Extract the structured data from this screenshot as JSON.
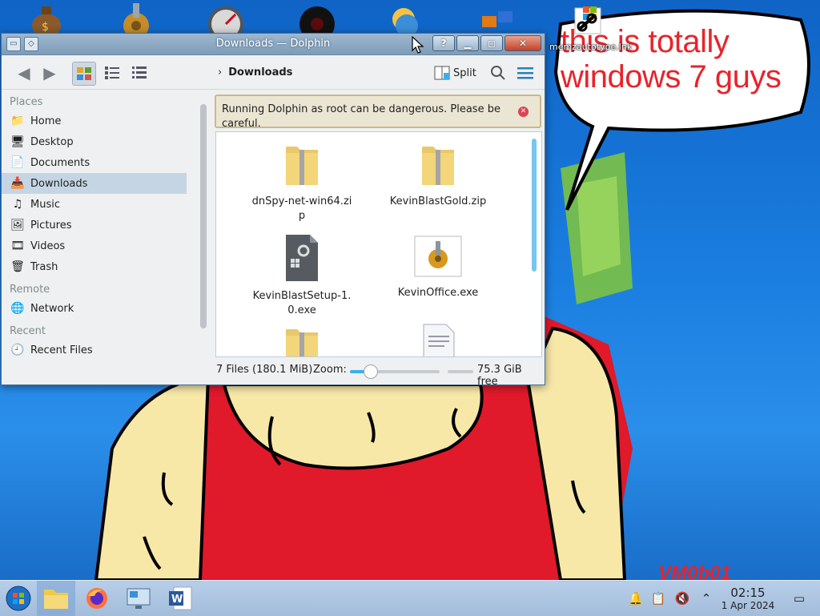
{
  "window": {
    "title": "Downloads — Dolphin",
    "help_btn": "?",
    "min_btn": "▁",
    "max_btn": "◻",
    "close_btn": "✕"
  },
  "toolbar": {
    "breadcrumb": "Downloads",
    "split_label": "Split",
    "back_icon": "left-arrow",
    "forward_icon": "right-arrow"
  },
  "sidebar": {
    "sections": [
      {
        "title": "Places",
        "items": [
          "Home",
          "Desktop",
          "Documents",
          "Downloads",
          "Music",
          "Pictures",
          "Videos",
          "Trash"
        ]
      },
      {
        "title": "Remote",
        "items": [
          "Network"
        ]
      },
      {
        "title": "Recent",
        "items": [
          "Recent Files"
        ]
      }
    ],
    "selected": "Downloads"
  },
  "banner": {
    "text": "Running Dolphin as root can be dangerous. Please be careful."
  },
  "files": [
    {
      "name": "dnSpy-net-win64.zip",
      "type": "zip"
    },
    {
      "name": "KevinBlastGold.zip",
      "type": "zip"
    },
    {
      "name": "KevinBlastSetup-1.0.exe",
      "type": "exe"
    },
    {
      "name": "KevinOffice.exe",
      "type": "exe-office"
    },
    {
      "name": "",
      "type": "zip"
    },
    {
      "name": "",
      "type": "doc"
    }
  ],
  "status": {
    "count": "7 Files (180.1 MiB)",
    "zoom_label": "Zoom:",
    "zoom_level": 0.22,
    "free_space": "75.3 GiB free"
  },
  "desktop": {
    "bubble_text": "this is totally windows 7 guys",
    "signature": "VM0b01",
    "shortcut_label": "memzautotype.lnk"
  },
  "clock": {
    "time": "02:15",
    "date": "1 Apr 2024"
  },
  "colors": {
    "accent": "#3daee9",
    "banner_border": "#c9b98a",
    "bubble_text": "#e8232b"
  }
}
